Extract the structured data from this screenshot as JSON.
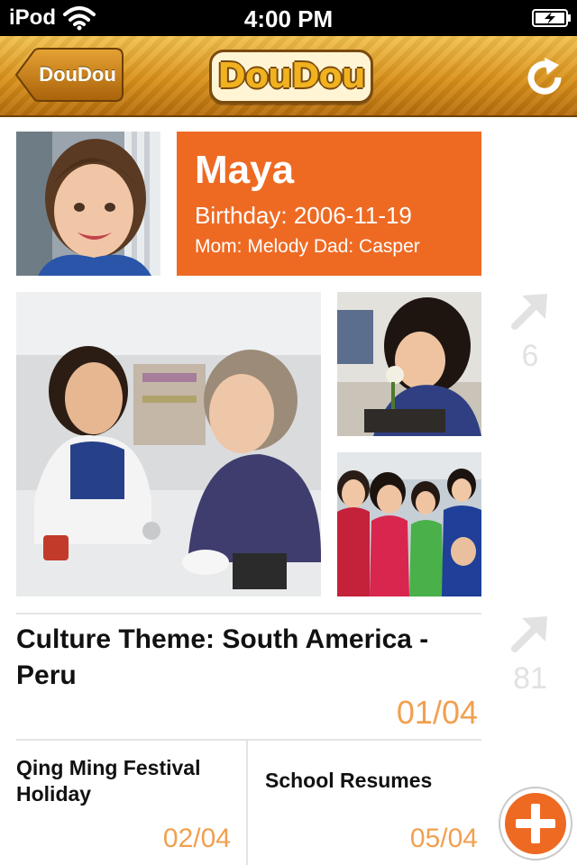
{
  "status_bar": {
    "carrier": "iPod",
    "time": "4:00 PM"
  },
  "nav": {
    "back_label": "DouDou",
    "logo_text": "DouDou"
  },
  "profile": {
    "name": "Maya",
    "birthday": "Birthday: 2006-11-19",
    "parents": "Mom: Melody  Dad: Casper",
    "card_color": "#ee6a23"
  },
  "gallery": {
    "share_count": "6"
  },
  "entries": {
    "featured": {
      "title": "Culture Theme: South America - Peru",
      "date": "01/04",
      "share_count": "81"
    },
    "items": [
      {
        "title": "Qing Ming Festival Holiday",
        "date": "02/04"
      },
      {
        "title": "School Resumes",
        "date": "05/04"
      }
    ]
  },
  "colors": {
    "accent": "#ee6a23",
    "date_text": "#f1a050",
    "nav_gold": "#d9911a"
  },
  "icons": {
    "back": "chevron-left-icon",
    "refresh": "refresh-icon",
    "share": "arrow-up-right-icon",
    "add": "plus-icon"
  }
}
